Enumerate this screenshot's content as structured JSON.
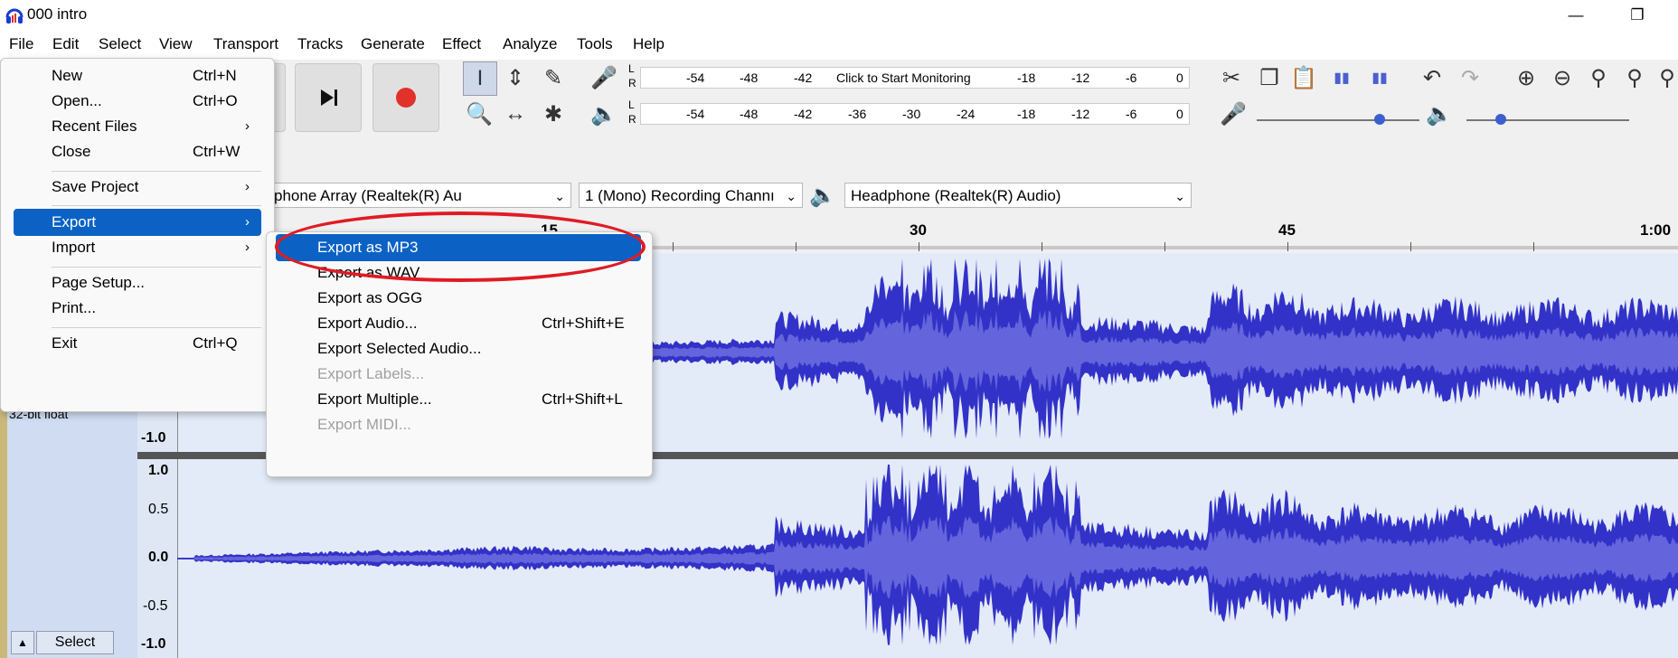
{
  "window": {
    "title": "000 intro",
    "minimize_icon": "minimize-icon",
    "restore_icon": "restore-icon"
  },
  "menubar": [
    "File",
    "Edit",
    "Select",
    "View",
    "Transport",
    "Tracks",
    "Generate",
    "Effect",
    "Analyze",
    "Tools",
    "Help"
  ],
  "meters": {
    "record_ticks": [
      "-54",
      "-48",
      "-42",
      "-18",
      "-12",
      "-6",
      "0"
    ],
    "record_prompt": "Click to Start Monitoring",
    "playback_ticks": [
      "-54",
      "-48",
      "-42",
      "-36",
      "-30",
      "-24",
      "-18",
      "-12",
      "-6",
      "0"
    ],
    "L": "L",
    "R": "R"
  },
  "devices": {
    "recording_device": "phone Array (Realtek(R) Au",
    "channels": "1 (Mono) Recording Channı",
    "playback_device": "Headphone (Realtek(R) Audio)"
  },
  "ruler": {
    "labels": [
      "15",
      "30",
      "45",
      "1:00"
    ]
  },
  "track": {
    "format": "32-bit float",
    "scale_top": [
      "-1.0"
    ],
    "scale_bottom": [
      "1.0",
      "0.5",
      "0.0",
      "-0.5",
      "-1.0"
    ],
    "select_label": "Select"
  },
  "file_menu": {
    "items": [
      {
        "label": "New",
        "shortcut": "Ctrl+N"
      },
      {
        "label": "Open...",
        "shortcut": "Ctrl+O"
      },
      {
        "label": "Recent Files",
        "arrow": "›"
      },
      {
        "label": "Close",
        "shortcut": "Ctrl+W"
      },
      {
        "label": "Save Project",
        "arrow": "›"
      },
      {
        "label": "Export",
        "arrow": "›"
      },
      {
        "label": "Import",
        "arrow": "›"
      },
      {
        "label": "Page Setup..."
      },
      {
        "label": "Print..."
      },
      {
        "label": "Exit",
        "shortcut": "Ctrl+Q"
      }
    ]
  },
  "export_menu": {
    "items": [
      {
        "label": "Export as MP3"
      },
      {
        "label": "Export as WAV"
      },
      {
        "label": "Export as OGG"
      },
      {
        "label": "Export Audio...",
        "shortcut": "Ctrl+Shift+E"
      },
      {
        "label": "Export Selected Audio..."
      },
      {
        "label": "Export Labels..."
      },
      {
        "label": "Export Multiple...",
        "shortcut": "Ctrl+Shift+L"
      },
      {
        "label": "Export MIDI..."
      }
    ]
  },
  "colors": {
    "waveform": "#3232c8",
    "waveform_rms": "#6464dc",
    "highlight": "#0b62c4",
    "annotation": "#e01b24"
  }
}
